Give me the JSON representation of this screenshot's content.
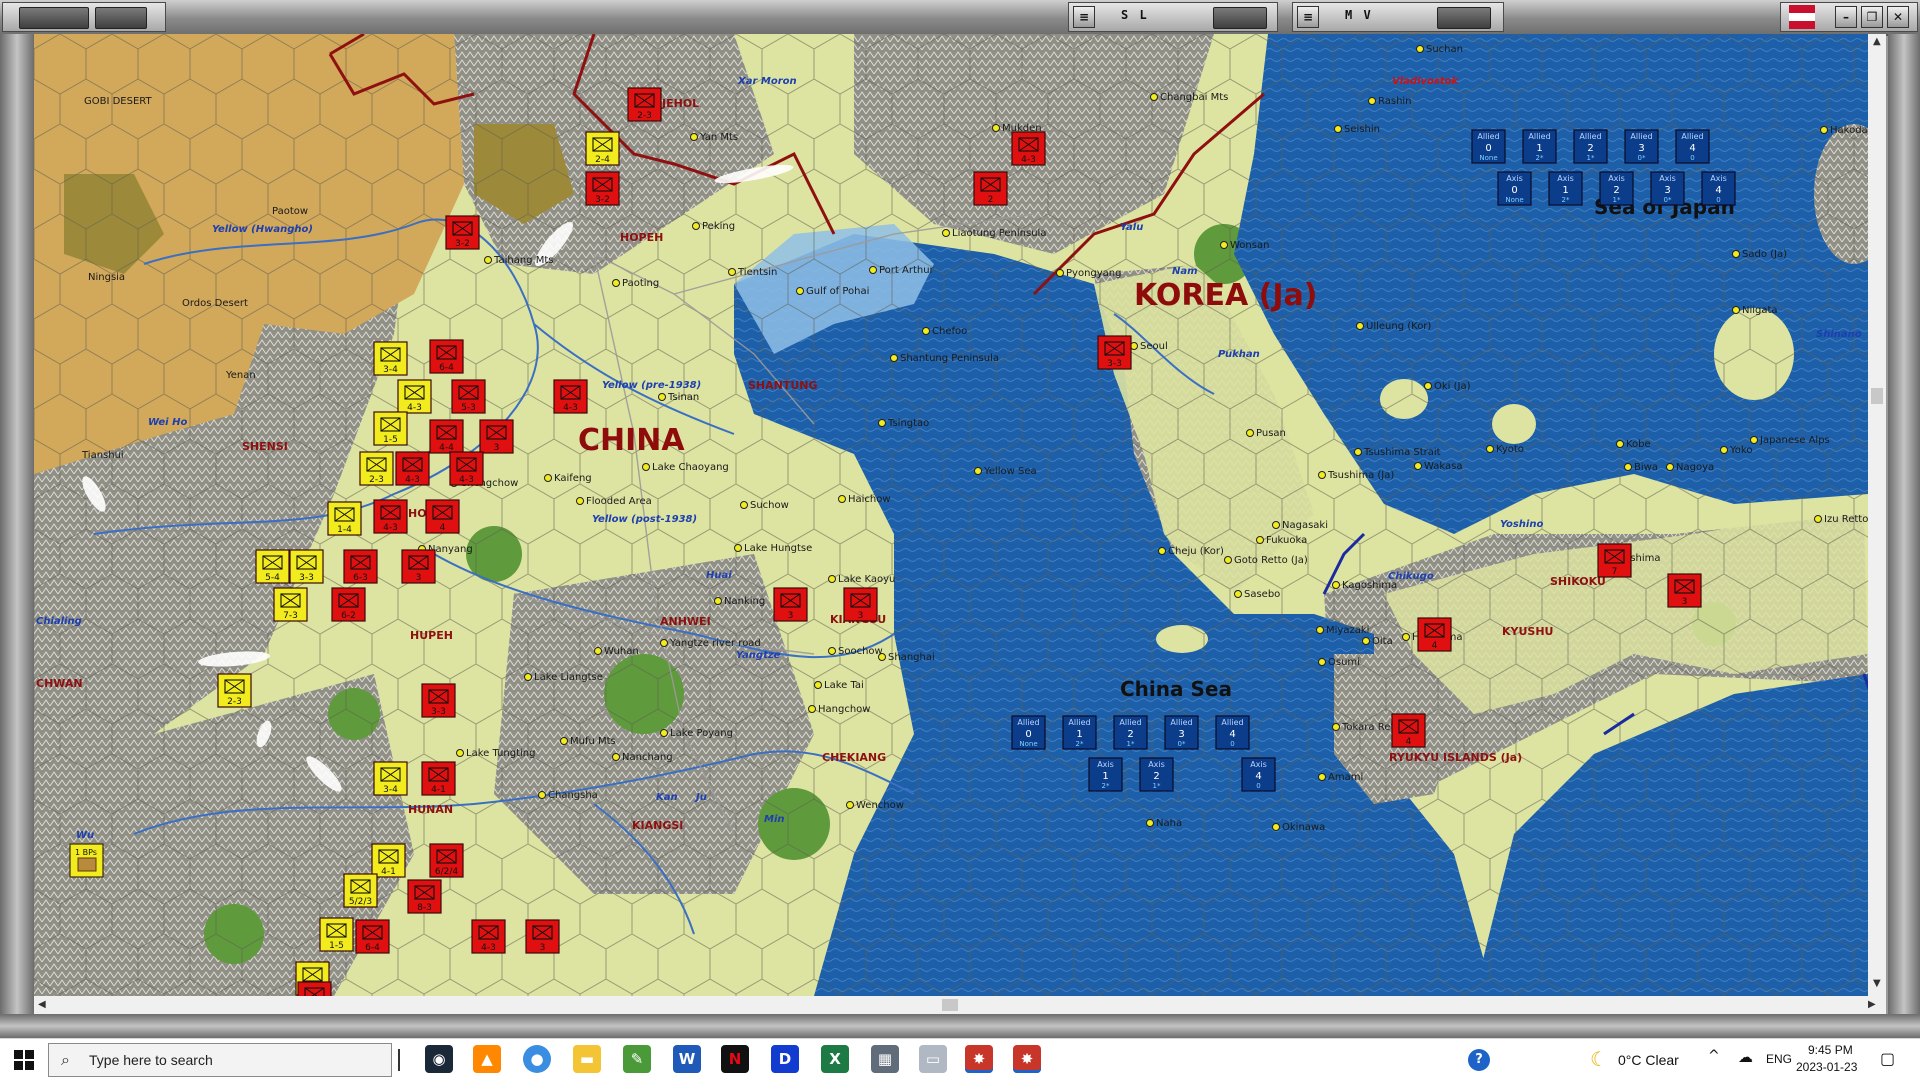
{
  "window": {
    "pane_sl_title": "S L",
    "pane_mv_title": "M V"
  },
  "colors": {
    "sea_deep": "#1d5fa8",
    "sea_shallow": "#8fbfe6",
    "clear_terrain": "#dde3a0",
    "desert": "#d2a85a",
    "mountain": "#8f8f86",
    "forest": "#5f9a3c",
    "allied_unit": "#f2ec1e",
    "axis_unit": "#e01010"
  },
  "labels": {
    "country": [
      {
        "text": "CHINA"
      },
      {
        "text": "KOREA (Ja)"
      }
    ],
    "sea": [
      {
        "text": "Sea of Japan"
      },
      {
        "text": "China Sea"
      }
    ],
    "region": [
      {
        "text": "JEHOL"
      },
      {
        "text": "HOPEH"
      },
      {
        "text": "SHANTUNG"
      },
      {
        "text": "SHENSI"
      },
      {
        "text": "HONAN"
      },
      {
        "text": "HUPEH"
      },
      {
        "text": "ANHWEI"
      },
      {
        "text": "KIANGSU"
      },
      {
        "text": "CHEKIANG"
      },
      {
        "text": "HUNAN"
      },
      {
        "text": "KIANGSI"
      },
      {
        "text": "CHWAN"
      },
      {
        "text": "SHIKOKU"
      },
      {
        "text": "KYUSHU"
      },
      {
        "text": "RYUKYU ISLANDS (Ja)"
      }
    ],
    "place": [
      {
        "text": "GOBI DESERT"
      },
      {
        "text": "Ordos Desert"
      },
      {
        "text": "Paotow"
      },
      {
        "text": "Ningsia"
      },
      {
        "text": "Yenan"
      },
      {
        "text": "Tianshui"
      },
      {
        "text": "Peking"
      },
      {
        "text": "Tientsin"
      },
      {
        "text": "Paoting"
      },
      {
        "text": "Taihang Mts"
      },
      {
        "text": "Yan Mts"
      },
      {
        "text": "Mukden"
      },
      {
        "text": "Changbai Mts"
      },
      {
        "text": "Liaotung Peninsula"
      },
      {
        "text": "Port Arthur"
      },
      {
        "text": "Gulf of Pohai"
      },
      {
        "text": "Chefoo"
      },
      {
        "text": "Shantung Peninsula"
      },
      {
        "text": "Tsinan"
      },
      {
        "text": "Tsingtao"
      },
      {
        "text": "Kaifeng"
      },
      {
        "text": "Chengchow"
      },
      {
        "text": "Lake Chaoyang"
      },
      {
        "text": "Flooded Area"
      },
      {
        "text": "Suchow"
      },
      {
        "text": "Haichow"
      },
      {
        "text": "Yellow Sea"
      },
      {
        "text": "Nanyang"
      },
      {
        "text": "Lake Hungtse"
      },
      {
        "text": "Nanking"
      },
      {
        "text": "Lake Kaoyu"
      },
      {
        "text": "Soochow"
      },
      {
        "text": "Shanghai"
      },
      {
        "text": "Wuhan"
      },
      {
        "text": "Yangtze river road"
      },
      {
        "text": "Lake Liangtse"
      },
      {
        "text": "Lake Tai"
      },
      {
        "text": "Hangchow"
      },
      {
        "text": "Lake Poyang"
      },
      {
        "text": "Mufu Mts"
      },
      {
        "text": "Nanchang"
      },
      {
        "text": "Lake Tungting"
      },
      {
        "text": "Changsha"
      },
      {
        "text": "Wenchow"
      },
      {
        "text": "Pyongyang"
      },
      {
        "text": "Wonsan"
      },
      {
        "text": "Seoul"
      },
      {
        "text": "Pusan"
      },
      {
        "text": "Tsushima Strait"
      },
      {
        "text": "Tsushima (Ja)"
      },
      {
        "text": "Cheju (Kor)"
      },
      {
        "text": "Goto Retto (Ja)"
      },
      {
        "text": "Sasebo"
      },
      {
        "text": "Fukuoka"
      },
      {
        "text": "Nagasaki"
      },
      {
        "text": "Kagoshima"
      },
      {
        "text": "Miyazaki"
      },
      {
        "text": "Oita"
      },
      {
        "text": "Hiroshima"
      },
      {
        "text": "Wakasa"
      },
      {
        "text": "Kyoto"
      },
      {
        "text": "Kobe"
      },
      {
        "text": "Biwa"
      },
      {
        "text": "Nagoya"
      },
      {
        "text": "Yoko"
      },
      {
        "text": "Japanese Alps"
      },
      {
        "text": "Tokushima"
      },
      {
        "text": "Ulleung (Kor)"
      },
      {
        "text": "Oki (Ja)"
      },
      {
        "text": "Sado (Ja)"
      },
      {
        "text": "Niigata"
      },
      {
        "text": "Hakodate"
      },
      {
        "text": "Rashin"
      },
      {
        "text": "Seishin"
      },
      {
        "text": "Suchan"
      },
      {
        "text": "Izu Retto"
      },
      {
        "text": "Osumi"
      },
      {
        "text": "Tokara Retto"
      },
      {
        "text": "Amami"
      },
      {
        "text": "Naha"
      },
      {
        "text": "Okinawa"
      }
    ],
    "river": [
      {
        "text": "Xar Moron"
      },
      {
        "text": "Yellow (Hwangho)"
      },
      {
        "text": "Yellow (pre-1938)"
      },
      {
        "text": "Yellow (post-1938)"
      },
      {
        "text": "Wei Ho"
      },
      {
        "text": "Huai"
      },
      {
        "text": "Yangtze"
      },
      {
        "text": "Kan"
      },
      {
        "text": "Ju"
      },
      {
        "text": "Min"
      },
      {
        "text": "Wu"
      },
      {
        "text": "Chialing"
      },
      {
        "text": "Yalu"
      },
      {
        "text": "Nam"
      },
      {
        "text": "Pukhan"
      },
      {
        "text": "Chikugo"
      },
      {
        "text": "Yoshino"
      },
      {
        "text": "Shinano"
      }
    ],
    "enemy_city": [
      {
        "text": "Vladivostok"
      }
    ]
  },
  "sea_boxes": {
    "sea_of_japan": {
      "allied": [
        {
          "label": "Allied",
          "num": "0",
          "sub": "None"
        },
        {
          "label": "Allied",
          "num": "1",
          "sub": "2*"
        },
        {
          "label": "Allied",
          "num": "2",
          "sub": "1*"
        },
        {
          "label": "Allied",
          "num": "3",
          "sub": "0*"
        },
        {
          "label": "Allied",
          "num": "4",
          "sub": "0"
        }
      ],
      "axis": [
        {
          "label": "Axis",
          "num": "0",
          "sub": "None"
        },
        {
          "label": "Axis",
          "num": "1",
          "sub": "2*"
        },
        {
          "label": "Axis",
          "num": "2",
          "sub": "1*"
        },
        {
          "label": "Axis",
          "num": "3",
          "sub": "0*"
        },
        {
          "label": "Axis",
          "num": "4",
          "sub": "0"
        }
      ]
    },
    "china_sea": {
      "allied": [
        {
          "label": "Allied",
          "num": "0",
          "sub": "None"
        },
        {
          "label": "Allied",
          "num": "1",
          "sub": "2*"
        },
        {
          "label": "Allied",
          "num": "2",
          "sub": "1*"
        },
        {
          "label": "Allied",
          "num": "3",
          "sub": "0*"
        },
        {
          "label": "Allied",
          "num": "4",
          "sub": "0"
        }
      ],
      "axis": [
        {
          "label": "",
          "num": "",
          "sub": ""
        },
        {
          "label": "Axis",
          "num": "1",
          "sub": "2*"
        },
        {
          "label": "Axis",
          "num": "2",
          "sub": "1*"
        },
        {
          "label": "",
          "num": "",
          "sub": ""
        },
        {
          "label": "Axis",
          "num": "4",
          "sub": "0"
        }
      ]
    }
  },
  "allied_units": [
    {
      "text": "2-4"
    },
    {
      "text": "3-4"
    },
    {
      "text": "4-3"
    },
    {
      "text": "1-5"
    },
    {
      "text": "2-3"
    },
    {
      "text": "1-4"
    },
    {
      "text": "3-3"
    },
    {
      "text": "5-4"
    },
    {
      "text": "7-3"
    },
    {
      "text": "2-3"
    },
    {
      "text": "3-4"
    },
    {
      "text": "4-1"
    },
    {
      "text": "5/2/3"
    },
    {
      "text": "1-5"
    },
    {
      "text": "6-2"
    }
  ],
  "axis_units": [
    {
      "text": "2-3"
    },
    {
      "text": "3-2"
    },
    {
      "text": "3-2"
    },
    {
      "text": "6-4"
    },
    {
      "text": "5-3"
    },
    {
      "text": "4-3"
    },
    {
      "text": "4-4"
    },
    {
      "text": "3"
    },
    {
      "text": "4-3"
    },
    {
      "text": "4-3"
    },
    {
      "text": "4-3"
    },
    {
      "text": "4"
    },
    {
      "text": "6-3"
    },
    {
      "text": "3"
    },
    {
      "text": "6-2"
    },
    {
      "text": "3-3"
    },
    {
      "text": "3"
    },
    {
      "text": "3"
    },
    {
      "text": "4-1"
    },
    {
      "text": "6/2/4"
    },
    {
      "text": "8-3"
    },
    {
      "text": "6-4"
    },
    {
      "text": "4-3"
    },
    {
      "text": "3"
    },
    {
      "text": "4-3"
    },
    {
      "text": "3-3"
    },
    {
      "text": "4-3"
    },
    {
      "text": "2"
    },
    {
      "text": "7"
    },
    {
      "text": "3"
    },
    {
      "text": "4"
    },
    {
      "text": "4"
    }
  ],
  "resource_marker": {
    "text": "1 BPs"
  },
  "taskbar": {
    "search_placeholder": "Type here to search",
    "weather": "0°C  Clear",
    "lang": "ENG",
    "time": "9:45 PM",
    "date": "2023-01-23"
  }
}
